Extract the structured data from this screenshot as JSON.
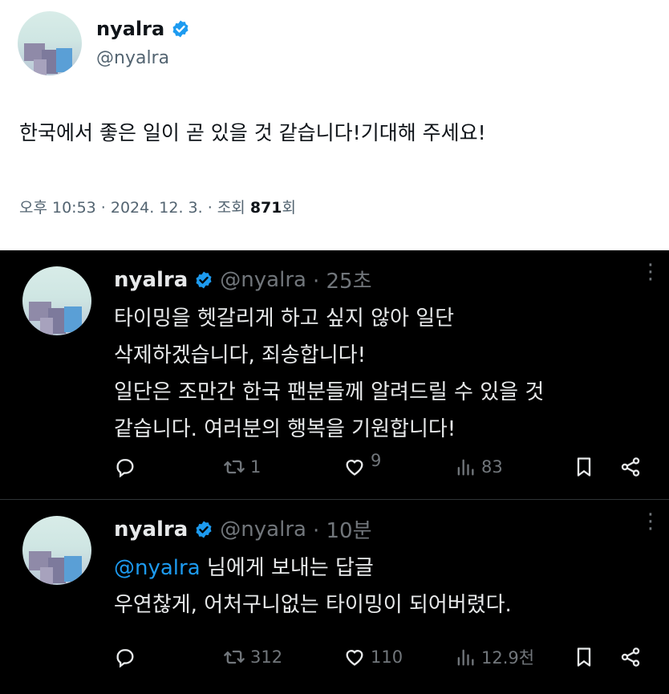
{
  "main_tweet": {
    "name": "nyalra",
    "handle": "@nyalra",
    "text": "한국에서 좋은 일이 곧 있을 것 같습니다!기대해 주세요!",
    "time_date": "오후 10:53 · 2024. 12. 3. · 조회 ",
    "views": "871",
    "views_suffix": "회"
  },
  "reply_1": {
    "name": "nyalra",
    "handle": "@nyalra",
    "time": "· 25초",
    "lines": [
      "타이밍을 헷갈리게 하고 싶지 않아 일단",
      "삭제하겠습니다, 죄송합니다!",
      "일단은 조만간 한국 팬분들께 알려드릴 수 있을 것",
      "같습니다. 여러분의 행복을 기원합니다!"
    ],
    "reply_count": "",
    "retweet_count": "1",
    "like_count": "9",
    "view_count": "83"
  },
  "reply_2": {
    "name": "nyalra",
    "handle": "@nyalra",
    "time": "· 10분",
    "mention": "@nyalra",
    "mention_suffix": " 님에게 보내는 답글",
    "text": "우연찮게, 어처구니없는 타이밍이 되어버렸다.",
    "reply_count": "",
    "retweet_count": "312",
    "like_count": "110",
    "view_count": "12.9천"
  },
  "colors": {
    "verified": "#1d9bf0",
    "light_text": "#0f1419",
    "light_secondary": "#536471",
    "dark_bg": "#000000",
    "dark_text": "#e7e9ea",
    "dark_secondary": "#71767b"
  },
  "icons": [
    "verified-badge-icon",
    "reply-icon",
    "retweet-icon",
    "like-icon",
    "views-icon",
    "bookmark-icon",
    "share-icon",
    "more-icon"
  ]
}
